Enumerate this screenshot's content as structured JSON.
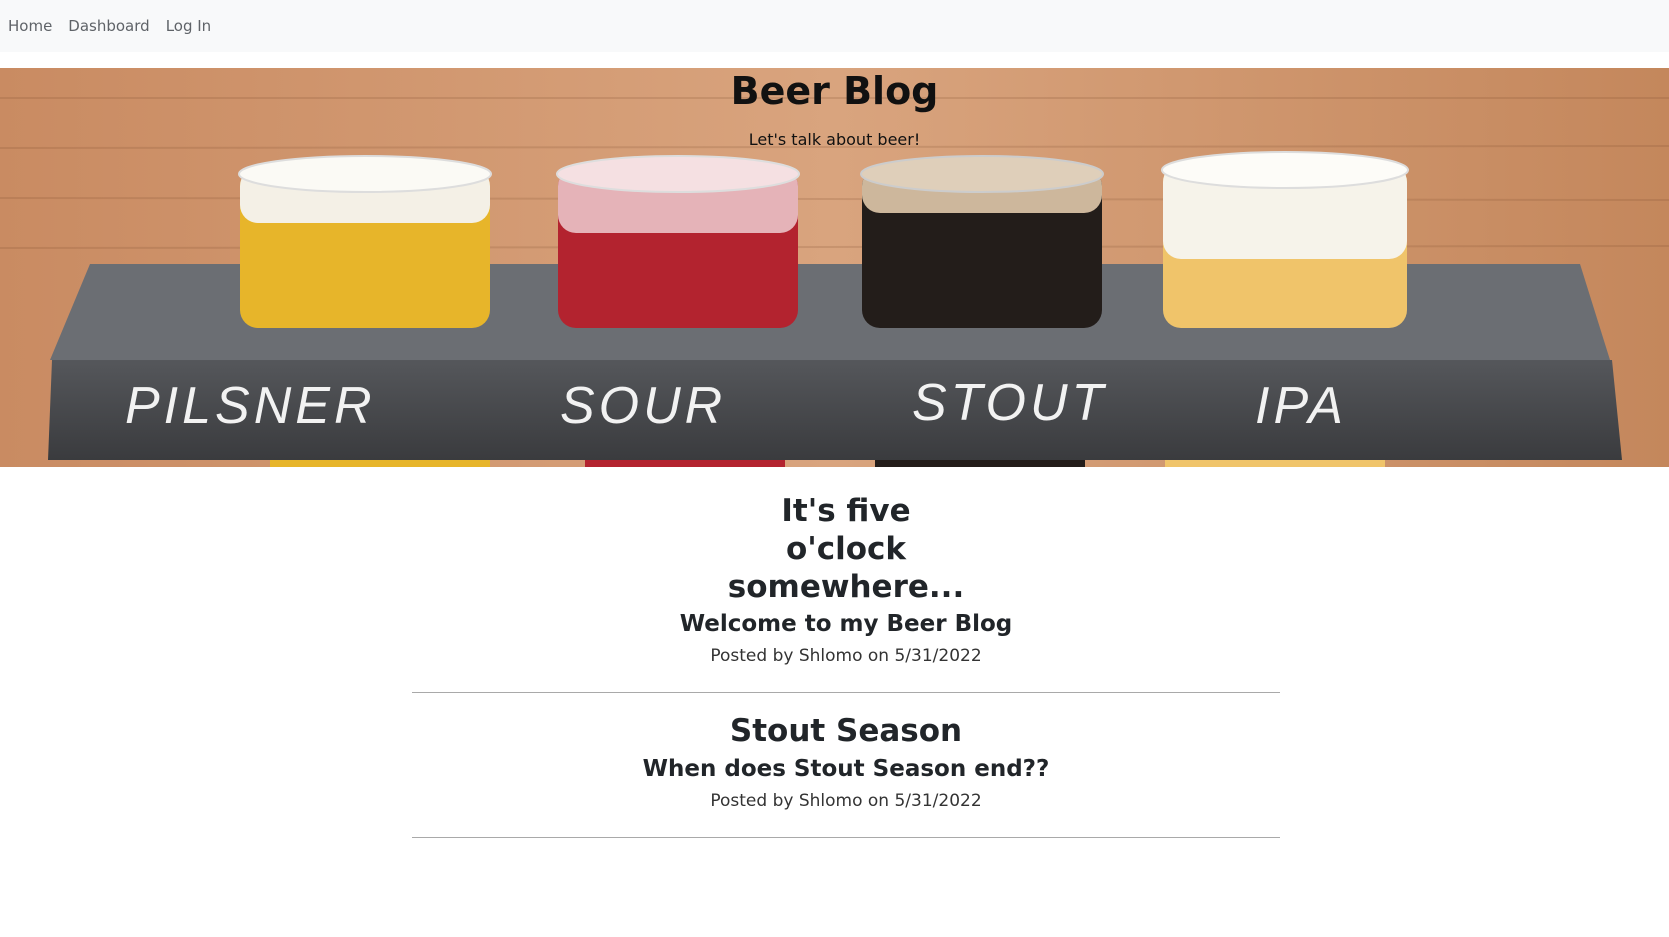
{
  "nav": {
    "items": [
      {
        "label": "Home"
      },
      {
        "label": "Dashboard"
      },
      {
        "label": "Log In"
      }
    ]
  },
  "hero": {
    "title": "Beer Blog",
    "subtitle": "Let's talk about beer!",
    "glass_labels": [
      "PILSNER",
      "SOUR",
      "STOUT",
      "IPA"
    ]
  },
  "posts": [
    {
      "title": "It's five o'clock somewhere...",
      "subtitle": "Welcome to my Beer Blog",
      "meta": "Posted by Shlomo on 5/31/2022"
    },
    {
      "title": "Stout Season",
      "subtitle": "When does Stout Season end??",
      "meta": "Posted by Shlomo on 5/31/2022"
    }
  ],
  "colors": {
    "navbar_bg": "#f8f9fa",
    "nav_link": "#5f6368",
    "divider": "#a9a9a9",
    "pilsner": "#e7b52a",
    "sour": "#b3232f",
    "stout": "#231d1a",
    "ipa": "#f0c46a"
  }
}
